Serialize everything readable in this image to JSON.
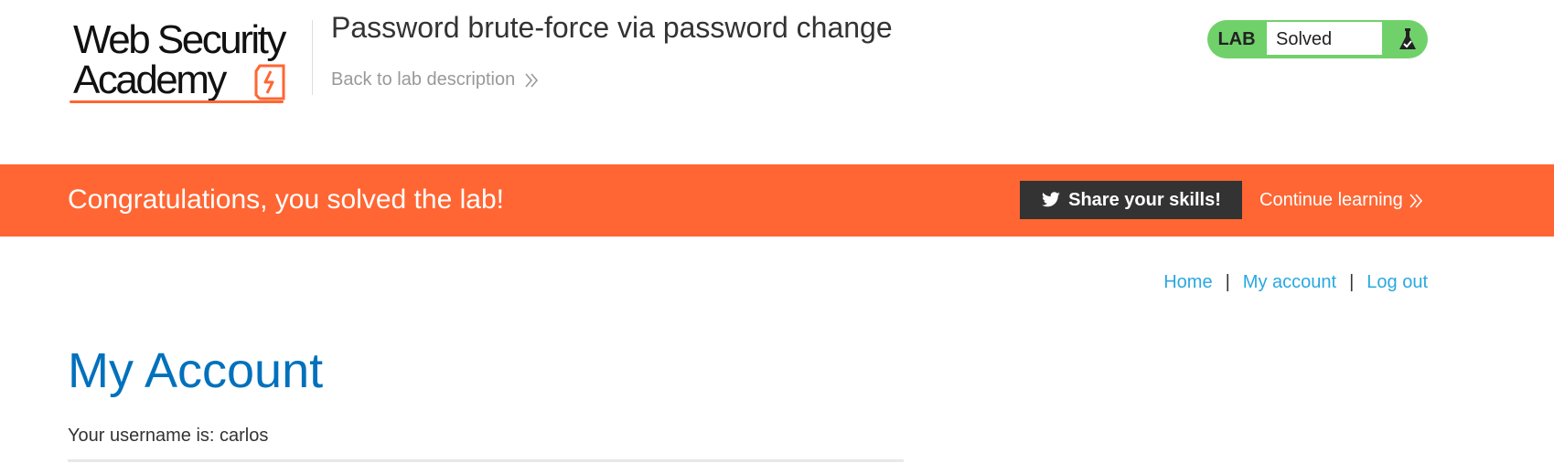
{
  "logo": {
    "line1": "Web Security",
    "line2": "Academy"
  },
  "header": {
    "title": "Password brute-force via password change",
    "back_link": "Back to lab description"
  },
  "lab_status": {
    "label": "LAB",
    "value": "Solved",
    "icon": "flask-icon"
  },
  "banner": {
    "message": "Congratulations, you solved the lab!",
    "share_label": "Share your skills!",
    "share_icon": "twitter-icon",
    "continue_label": "Continue learning"
  },
  "nav": {
    "home": "Home",
    "sep1": "|",
    "account": "My account",
    "sep2": "|",
    "logout": "Log out"
  },
  "main": {
    "title": "My Account",
    "username_text": "Your username is: carlos"
  },
  "colors": {
    "brand_orange": "#ff6633",
    "lab_green": "#70d16a",
    "link_blue": "#29a8e0",
    "title_blue": "#0071bc",
    "dark": "#333333"
  }
}
